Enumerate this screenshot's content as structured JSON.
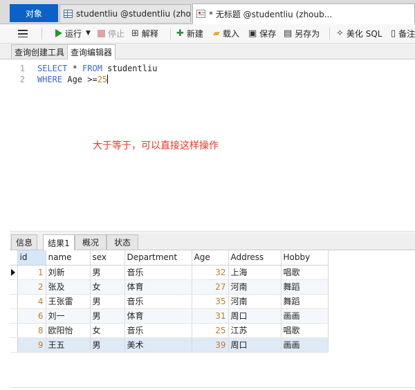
{
  "tabs": {
    "objects": "对象",
    "table_tab": "studentliu @studentliu (zho...",
    "query_tab": "* 无标题 @studentliu (zhoub..."
  },
  "toolbar": {
    "run": "运行",
    "stop": "停止",
    "explain": "解释",
    "new": "新建",
    "load": "载入",
    "save": "保存",
    "save_as": "另存为",
    "beautify": "美化 SQL",
    "backup": "备注"
  },
  "subtabs": {
    "builder": "查询创建工具",
    "editor": "查询编辑器"
  },
  "editor": {
    "line1_no": "1",
    "line2_no": "2",
    "kw_select": "SELECT",
    "star": " * ",
    "kw_from": "FROM",
    "table": " studentliu",
    "kw_where": "WHERE",
    "cond": " Age >=",
    "value": "25"
  },
  "annotation": "大于等于，可以直接这样操作",
  "result_tabs": [
    "信息",
    "结果1",
    "概况",
    "状态"
  ],
  "grid": {
    "columns": [
      "id",
      "name",
      "sex",
      "Department",
      "Age",
      "Address",
      "Hobby"
    ],
    "rows": [
      [
        "1",
        "刘新",
        "男",
        "音乐",
        "32",
        "上海",
        "唱歌"
      ],
      [
        "2",
        "张及",
        "女",
        "体育",
        "27",
        "河南",
        "舞蹈"
      ],
      [
        "4",
        "王张雷",
        "男",
        "音乐",
        "35",
        "河南",
        "舞蹈"
      ],
      [
        "6",
        "刘一",
        "男",
        "体育",
        "31",
        "周口",
        "画画"
      ],
      [
        "8",
        "欧阳怡",
        "女",
        "音乐",
        "25",
        "江苏",
        "唱歌"
      ],
      [
        "9",
        "王五",
        "男",
        "美术",
        "39",
        "周口",
        "画画"
      ]
    ]
  },
  "colors": {
    "accent": "#0b61c6",
    "keyword": "#3b69c8",
    "number": "#c27b28",
    "annotation": "#e8352a",
    "run_icon": "#1f9a2d"
  }
}
